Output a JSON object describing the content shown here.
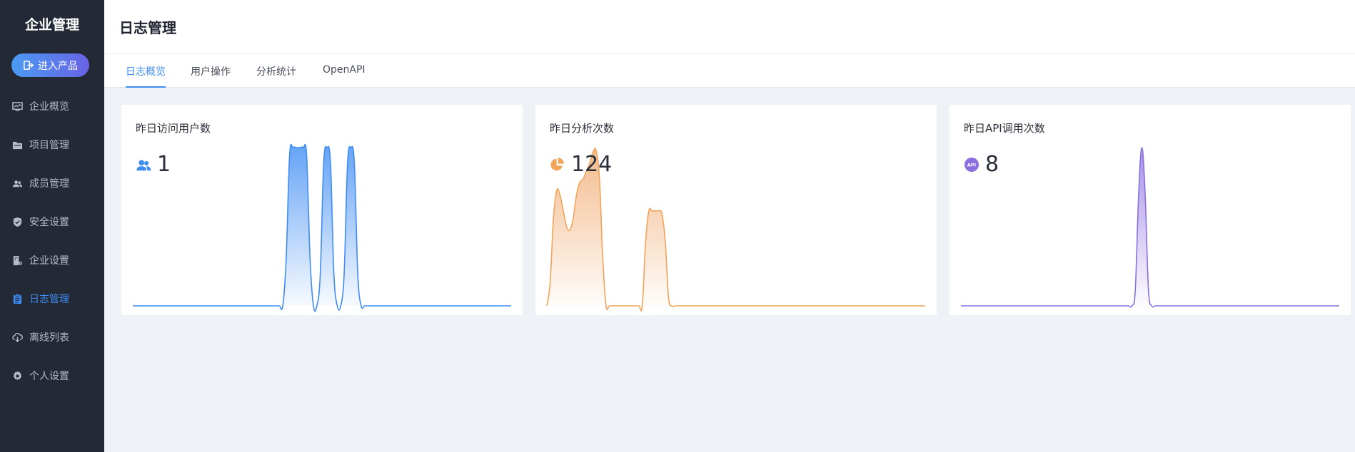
{
  "sidebar": {
    "brand": "企业管理",
    "enter_button": "进入产品",
    "items": [
      {
        "label": "企业概览",
        "icon": "monitor-icon"
      },
      {
        "label": "项目管理",
        "icon": "folder-icon"
      },
      {
        "label": "成员管理",
        "icon": "users-icon"
      },
      {
        "label": "安全设置",
        "icon": "shield-icon"
      },
      {
        "label": "企业设置",
        "icon": "building-settings-icon"
      },
      {
        "label": "日志管理",
        "icon": "clipboard-icon",
        "active": true
      },
      {
        "label": "离线列表",
        "icon": "cloud-download-icon"
      },
      {
        "label": "个人设置",
        "icon": "gear-icon"
      }
    ]
  },
  "header": {
    "title": "日志管理"
  },
  "tabs": [
    "日志概览",
    "用户操作",
    "分析统计",
    "OpenAPI"
  ],
  "colors": {
    "accent": "#3f8cf2",
    "orange": "#f0a45c",
    "purple": "#8a6fe0",
    "sidebar_bg": "#232a36"
  },
  "cards": [
    {
      "title": "昨日访问用户数",
      "value": "1",
      "icon": "users-icon",
      "color": "#3f8cf2",
      "fill_top": "#5c9ef5",
      "series": [
        0,
        0,
        0,
        0,
        0,
        0,
        0,
        0,
        0,
        0,
        0,
        0,
        0,
        0,
        0,
        0,
        0,
        0,
        0,
        0,
        0,
        0,
        0,
        0,
        0,
        0,
        0,
        0,
        0,
        0,
        0,
        0,
        0,
        0,
        0,
        0,
        0,
        0,
        0,
        0,
        0,
        0,
        0,
        0,
        0,
        0.3,
        0.95,
        1,
        1,
        1,
        1,
        0.95,
        0.3,
        0,
        0,
        0.2,
        0.9,
        1,
        0.9,
        0.2,
        0,
        0,
        0.2,
        0.9,
        1,
        0.9,
        0.2,
        0,
        0,
        0,
        0,
        0,
        0,
        0,
        0,
        0,
        0,
        0,
        0,
        0,
        0,
        0,
        0,
        0,
        0,
        0,
        0,
        0,
        0,
        0,
        0,
        0,
        0,
        0,
        0,
        0,
        0,
        0,
        0,
        0,
        0,
        0,
        0,
        0,
        0,
        0,
        0,
        0,
        0,
        0,
        0,
        0
      ]
    },
    {
      "title": "昨日分析次数",
      "value": "124",
      "icon": "pie-chart-icon",
      "color": "#f0a45c",
      "fill_top": "#f3b887",
      "series": [
        0,
        0.15,
        0.55,
        0.73,
        0.7,
        0.6,
        0.5,
        0.48,
        0.55,
        0.7,
        0.78,
        0.8,
        0.85,
        0.9,
        0.97,
        0.98,
        0.8,
        0.3,
        0,
        0,
        0,
        0,
        0,
        0,
        0,
        0,
        0,
        0,
        0,
        0,
        0.4,
        0.6,
        0.6,
        0.6,
        0.6,
        0.58,
        0.4,
        0.05,
        0,
        0,
        0,
        0,
        0,
        0,
        0,
        0,
        0,
        0,
        0,
        0,
        0,
        0,
        0,
        0,
        0,
        0,
        0,
        0,
        0,
        0,
        0,
        0,
        0,
        0,
        0,
        0,
        0,
        0,
        0,
        0,
        0,
        0,
        0,
        0,
        0,
        0,
        0,
        0,
        0,
        0,
        0,
        0,
        0,
        0,
        0,
        0,
        0,
        0,
        0,
        0,
        0,
        0,
        0,
        0,
        0,
        0,
        0,
        0,
        0,
        0,
        0,
        0,
        0,
        0,
        0,
        0,
        0,
        0,
        0,
        0,
        0,
        0,
        0,
        0,
        0,
        0
      ]
    },
    {
      "title": "昨日API调用次数",
      "value": "8",
      "icon": "api-icon",
      "color": "#8a6fe0",
      "fill_top": "#a48ce8",
      "series": [
        0,
        0,
        0,
        0,
        0,
        0,
        0,
        0,
        0,
        0,
        0,
        0,
        0,
        0,
        0,
        0,
        0,
        0,
        0,
        0,
        0,
        0,
        0,
        0,
        0,
        0,
        0,
        0,
        0,
        0,
        0,
        0,
        0,
        0,
        0,
        0,
        0,
        0,
        0,
        0,
        0,
        0,
        0,
        0,
        0,
        0,
        0,
        0,
        0,
        0,
        0,
        0,
        0,
        0.1,
        0.7,
        1,
        0.7,
        0.1,
        0,
        0,
        0,
        0,
        0,
        0,
        0,
        0,
        0,
        0,
        0,
        0,
        0,
        0,
        0,
        0,
        0,
        0,
        0,
        0,
        0,
        0,
        0,
        0,
        0,
        0,
        0,
        0,
        0,
        0,
        0,
        0,
        0,
        0,
        0,
        0,
        0,
        0,
        0,
        0,
        0,
        0,
        0,
        0,
        0,
        0,
        0,
        0,
        0,
        0,
        0,
        0,
        0,
        0,
        0,
        0,
        0,
        0
      ]
    }
  ]
}
